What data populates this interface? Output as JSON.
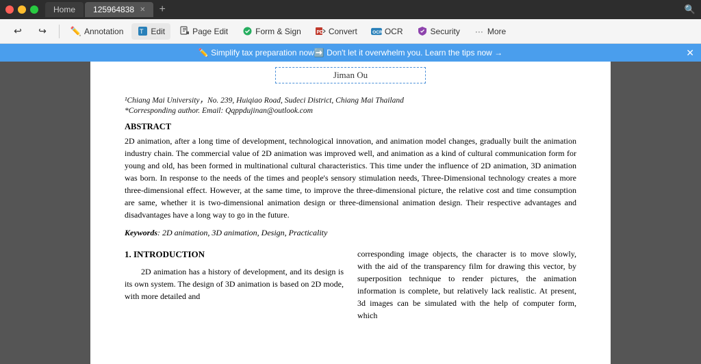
{
  "titlebar": {
    "tab1_label": "Home",
    "tab2_label": "125964838",
    "new_tab_label": "+",
    "traffic": [
      "close",
      "minimize",
      "maximize"
    ]
  },
  "toolbar": {
    "undo_label": "",
    "redo_label": "",
    "annotation_label": "Annotation",
    "edit_label": "Edit",
    "page_edit_label": "Page Edit",
    "form_sign_label": "Form & Sign",
    "convert_label": "Convert",
    "ocr_label": "OCR",
    "security_label": "Security",
    "more_label": "More"
  },
  "banner": {
    "text": "✏️  Simplify tax preparation now➡️  Don't let it overwhelm you. Learn the tips now →",
    "close_label": "✕"
  },
  "document": {
    "title_partial": "Jiman Ou",
    "affiliation": "¹Chiang Mai University，No. 239, Huiqiao Road, Sudeci District, Chiang Mai Thailand",
    "corresponding": "*Corresponding author. Email: Qqppdujinan@outlook.com",
    "abstract_head": "ABSTRACT",
    "abstract_body": "2D animation, after a long time of development, technological innovation, and animation model changes, gradually built the animation industry chain. The commercial value of 2D animation was improved well, and animation as a kind of cultural communication form for young and old, has been formed in multinational cultural characteristics. This time under the influence of 2D animation, 3D animation was born. In response to the needs of the times and people's sensory stimulation needs, Three-Dimensional technology creates a more three-dimensional effect. However, at the same time, to improve the three-dimensional picture, the relative cost and time consumption are same, whether it is two-dimensional animation design or three-dimensional animation design. Their respective advantages and disadvantages have a long way to go in the future.",
    "keywords_label": "Keywords",
    "keywords_value": ": 2D animation, 3D animation, Design, Practicality",
    "section1_head": "1. INTRODUCTION",
    "col1_body": "2D animation has a history of development, and its design is its own system. The design of 3D animation is based on 2D mode, with more detailed and",
    "col2_body": "corresponding image objects, the character is to move slowly, with the aid of the transparency film for drawing this vector, by superposition technique to render pictures, the animation information is complete, but relatively lack realistic. At present, 3d images can be simulated with the help of computer form, which"
  }
}
